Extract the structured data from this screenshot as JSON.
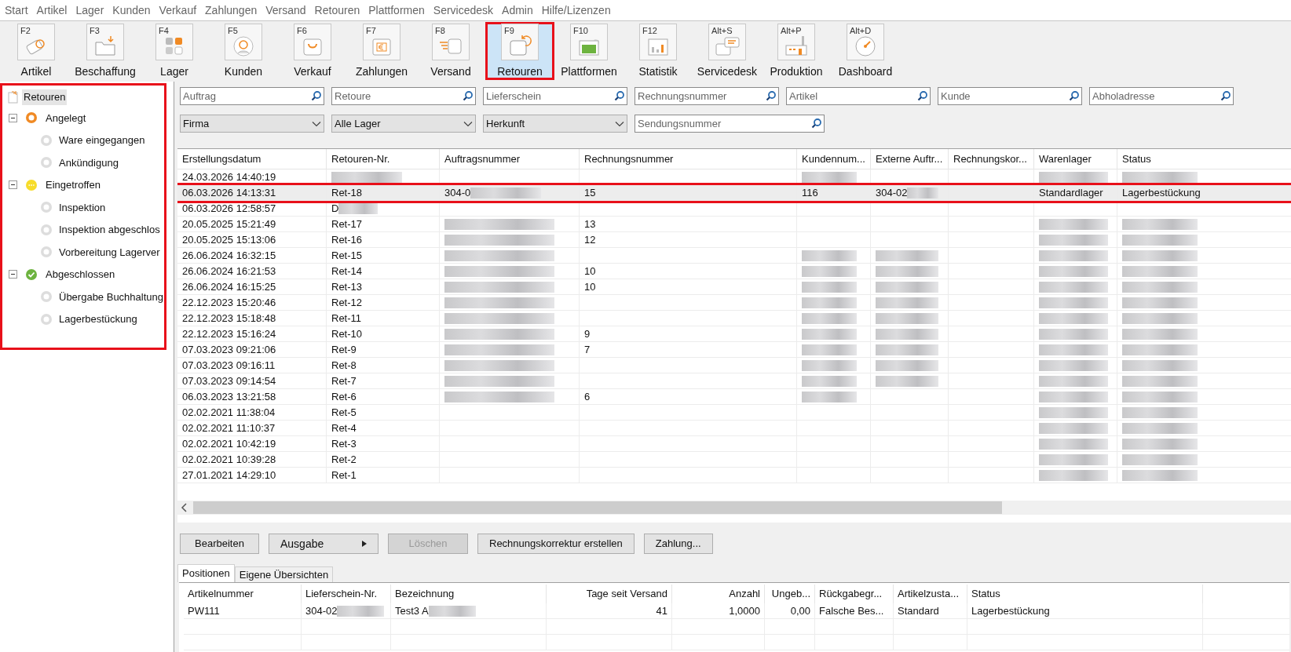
{
  "menu": [
    "Start",
    "Artikel",
    "Lager",
    "Kunden",
    "Verkauf",
    "Zahlungen",
    "Versand",
    "Retouren",
    "Plattformen",
    "Servicedesk",
    "Admin",
    "Hilfe/Lizenzen"
  ],
  "toolbar": [
    {
      "key": "F2",
      "label": "Artikel",
      "selected": false,
      "highlighted": false
    },
    {
      "key": "F3",
      "label": "Beschaffung",
      "selected": false,
      "highlighted": false
    },
    {
      "key": "F4",
      "label": "Lager",
      "selected": false,
      "highlighted": false
    },
    {
      "key": "F5",
      "label": "Kunden",
      "selected": false,
      "highlighted": false
    },
    {
      "key": "F6",
      "label": "Verkauf",
      "selected": false,
      "highlighted": false
    },
    {
      "key": "F7",
      "label": "Zahlungen",
      "selected": false,
      "highlighted": false
    },
    {
      "key": "F8",
      "label": "Versand",
      "selected": false,
      "highlighted": false
    },
    {
      "key": "F9",
      "label": "Retouren",
      "selected": true,
      "highlighted": true
    },
    {
      "key": "F10",
      "label": "Plattformen",
      "selected": false,
      "highlighted": false
    },
    {
      "key": "F12",
      "label": "Statistik",
      "selected": false,
      "highlighted": false
    },
    {
      "key": "Alt+S",
      "label": "Servicedesk",
      "selected": false,
      "highlighted": false
    },
    {
      "key": "Alt+P",
      "label": "Produktion",
      "selected": false,
      "highlighted": false
    },
    {
      "key": "Alt+D",
      "label": "Dashboard",
      "selected": false,
      "highlighted": false
    }
  ],
  "tree": {
    "highlighted": true,
    "root": {
      "label": "Retouren",
      "selected": true,
      "children": [
        {
          "label": "Angelegt",
          "kind": "ring",
          "color": "#f08a24",
          "expanded": true,
          "children": [
            {
              "label": "Ware eingegangen"
            },
            {
              "label": "Ankündigung"
            }
          ]
        },
        {
          "label": "Eingetroffen",
          "kind": "dots",
          "color": "#f7dc2a",
          "expanded": true,
          "children": [
            {
              "label": "Inspektion"
            },
            {
              "label": "Inspektion abgeschlos"
            },
            {
              "label": "Vorbereitung Lagerver"
            }
          ]
        },
        {
          "label": "Abgeschlossen",
          "kind": "check",
          "color": "#6db33f",
          "expanded": true,
          "children": [
            {
              "label": "Übergabe Buchhaltung"
            },
            {
              "label": "Lagerbestückung"
            }
          ]
        }
      ]
    }
  },
  "search_fields": [
    {
      "placeholder": "Auftrag"
    },
    {
      "placeholder": "Retoure"
    },
    {
      "placeholder": "Lieferschein"
    },
    {
      "placeholder": "Rechnungsnummer"
    },
    {
      "placeholder": "Artikel"
    },
    {
      "placeholder": "Kunde"
    },
    {
      "placeholder": "Abholadresse"
    }
  ],
  "dropdowns": [
    {
      "value": "Firma"
    },
    {
      "value": "Alle Lager"
    },
    {
      "value": "Herkunft"
    }
  ],
  "shipment_search": {
    "placeholder": "Sendungsnummer"
  },
  "table": {
    "columns": [
      "Erstellungsdatum",
      "Retouren-Nr.",
      "Auftragsnummer",
      "Rechnungsnummer",
      "Kundennum...",
      "Externe Auftr...",
      "Rechnungskor...",
      "Warenlager",
      "Status"
    ],
    "rows": [
      {
        "selected": false,
        "highlighted": false,
        "cells": [
          {
            "text": "24.03.2026 14:40:19"
          },
          {
            "redacted": true
          },
          {},
          {},
          {
            "redacted": true
          },
          {},
          {},
          {
            "redacted": true
          },
          {
            "redacted": true
          }
        ]
      },
      {
        "selected": true,
        "highlighted": true,
        "cells": [
          {
            "text": "06.03.2026 14:13:31"
          },
          {
            "text": "Ret-18"
          },
          {
            "text": "304-0",
            "redacted": true
          },
          {
            "text": "15"
          },
          {
            "text": "116"
          },
          {
            "text": "304-02",
            "redacted": true
          },
          {},
          {
            "text": "Standardlager"
          },
          {
            "text": "Lagerbestückung"
          }
        ]
      },
      {
        "selected": false,
        "highlighted": false,
        "cells": [
          {
            "text": "06.03.2026 12:58:57"
          },
          {
            "text": "D",
            "redacted": true
          },
          {},
          {},
          {},
          {},
          {},
          {},
          {}
        ]
      },
      {
        "selected": false,
        "highlighted": false,
        "cells": [
          {
            "text": "20.05.2025 15:21:49"
          },
          {
            "text": "Ret-17"
          },
          {
            "redacted": true
          },
          {
            "text": "13"
          },
          {},
          {},
          {},
          {
            "redacted": true
          },
          {
            "redacted": true
          }
        ]
      },
      {
        "selected": false,
        "highlighted": false,
        "cells": [
          {
            "text": "20.05.2025 15:13:06"
          },
          {
            "text": "Ret-16"
          },
          {
            "redacted": true
          },
          {
            "text": "12"
          },
          {},
          {},
          {},
          {
            "redacted": true
          },
          {
            "redacted": true
          }
        ]
      },
      {
        "selected": false,
        "highlighted": false,
        "cells": [
          {
            "text": "26.06.2024 16:32:15"
          },
          {
            "text": "Ret-15"
          },
          {
            "redacted": true
          },
          {},
          {
            "redacted": true
          },
          {
            "redacted": true
          },
          {},
          {
            "redacted": true
          },
          {
            "redacted": true
          }
        ]
      },
      {
        "selected": false,
        "highlighted": false,
        "cells": [
          {
            "text": "26.06.2024 16:21:53"
          },
          {
            "text": "Ret-14"
          },
          {
            "redacted": true
          },
          {
            "text": "10"
          },
          {
            "redacted": true
          },
          {
            "redacted": true
          },
          {},
          {
            "redacted": true
          },
          {
            "redacted": true
          }
        ]
      },
      {
        "selected": false,
        "highlighted": false,
        "cells": [
          {
            "text": "26.06.2024 16:15:25"
          },
          {
            "text": "Ret-13"
          },
          {
            "redacted": true
          },
          {
            "text": "10"
          },
          {
            "redacted": true
          },
          {
            "redacted": true
          },
          {},
          {
            "redacted": true
          },
          {
            "redacted": true
          }
        ]
      },
      {
        "selected": false,
        "highlighted": false,
        "cells": [
          {
            "text": "22.12.2023 15:20:46"
          },
          {
            "text": "Ret-12"
          },
          {
            "redacted": true
          },
          {},
          {
            "redacted": true
          },
          {
            "redacted": true
          },
          {},
          {
            "redacted": true
          },
          {
            "redacted": true
          }
        ]
      },
      {
        "selected": false,
        "highlighted": false,
        "cells": [
          {
            "text": "22.12.2023 15:18:48"
          },
          {
            "text": "Ret-11"
          },
          {
            "redacted": true
          },
          {},
          {
            "redacted": true
          },
          {
            "redacted": true
          },
          {},
          {
            "redacted": true
          },
          {
            "redacted": true
          }
        ]
      },
      {
        "selected": false,
        "highlighted": false,
        "cells": [
          {
            "text": "22.12.2023 15:16:24"
          },
          {
            "text": "Ret-10"
          },
          {
            "redacted": true
          },
          {
            "text": "9"
          },
          {
            "redacted": true
          },
          {
            "redacted": true
          },
          {},
          {
            "redacted": true
          },
          {
            "redacted": true
          }
        ]
      },
      {
        "selected": false,
        "highlighted": false,
        "cells": [
          {
            "text": "07.03.2023 09:21:06"
          },
          {
            "text": "Ret-9"
          },
          {
            "redacted": true
          },
          {
            "text": "7"
          },
          {
            "redacted": true
          },
          {
            "redacted": true
          },
          {},
          {
            "redacted": true
          },
          {
            "redacted": true
          }
        ]
      },
      {
        "selected": false,
        "highlighted": false,
        "cells": [
          {
            "text": "07.03.2023 09:16:11"
          },
          {
            "text": "Ret-8"
          },
          {
            "redacted": true
          },
          {},
          {
            "redacted": true
          },
          {
            "redacted": true
          },
          {},
          {
            "redacted": true
          },
          {
            "redacted": true
          }
        ]
      },
      {
        "selected": false,
        "highlighted": false,
        "cells": [
          {
            "text": "07.03.2023 09:14:54"
          },
          {
            "text": "Ret-7"
          },
          {
            "redacted": true
          },
          {},
          {
            "redacted": true
          },
          {
            "redacted": true
          },
          {},
          {
            "redacted": true
          },
          {
            "redacted": true
          }
        ]
      },
      {
        "selected": false,
        "highlighted": false,
        "cells": [
          {
            "text": "06.03.2023 13:21:58"
          },
          {
            "text": "Ret-6"
          },
          {
            "redacted": true
          },
          {
            "text": "6"
          },
          {
            "redacted": true
          },
          {},
          {},
          {
            "redacted": true
          },
          {
            "redacted": true
          }
        ]
      },
      {
        "selected": false,
        "highlighted": false,
        "cells": [
          {
            "text": "02.02.2021 11:38:04"
          },
          {
            "text": "Ret-5"
          },
          {},
          {},
          {},
          {},
          {},
          {
            "redacted": true
          },
          {
            "redacted": true
          }
        ]
      },
      {
        "selected": false,
        "highlighted": false,
        "cells": [
          {
            "text": "02.02.2021 11:10:37"
          },
          {
            "text": "Ret-4"
          },
          {},
          {},
          {},
          {},
          {},
          {
            "redacted": true
          },
          {
            "redacted": true
          }
        ]
      },
      {
        "selected": false,
        "highlighted": false,
        "cells": [
          {
            "text": "02.02.2021 10:42:19"
          },
          {
            "text": "Ret-3"
          },
          {},
          {},
          {},
          {},
          {},
          {
            "redacted": true
          },
          {
            "redacted": true
          }
        ]
      },
      {
        "selected": false,
        "highlighted": false,
        "cells": [
          {
            "text": "02.02.2021 10:39:28"
          },
          {
            "text": "Ret-2"
          },
          {},
          {},
          {},
          {},
          {},
          {
            "redacted": true
          },
          {
            "redacted": true
          }
        ]
      },
      {
        "selected": false,
        "highlighted": false,
        "cells": [
          {
            "text": "27.01.2021 14:29:10"
          },
          {
            "text": "Ret-1"
          },
          {},
          {},
          {},
          {},
          {},
          {
            "redacted": true
          },
          {
            "redacted": true
          }
        ]
      }
    ]
  },
  "actions": [
    {
      "label": "Bearbeiten",
      "kind": "button",
      "disabled": false
    },
    {
      "label": "Ausgabe",
      "kind": "menu",
      "disabled": false
    },
    {
      "label": "Löschen",
      "kind": "button",
      "disabled": true
    },
    {
      "label": "Rechnungskorrektur erstellen",
      "kind": "button",
      "disabled": false
    },
    {
      "label": "Zahlung...",
      "kind": "button",
      "disabled": false
    }
  ],
  "detail_tabs": [
    {
      "label": "Positionen",
      "selected": true
    },
    {
      "label": "Eigene Übersichten",
      "selected": false
    }
  ],
  "positions": {
    "columns": [
      {
        "label": "Artikelnummer",
        "numeric": false
      },
      {
        "label": "Lieferschein-Nr.",
        "numeric": false
      },
      {
        "label": "Bezeichnung",
        "numeric": false
      },
      {
        "label": "Tage seit Versand",
        "numeric": true
      },
      {
        "label": "Anzahl",
        "numeric": true
      },
      {
        "label": "Ungeb...",
        "numeric": true
      },
      {
        "label": "Rückgabegr...",
        "numeric": false
      },
      {
        "label": "Artikelzusta...",
        "numeric": false
      },
      {
        "label": "Status",
        "numeric": false
      }
    ],
    "rows": [
      {
        "cells": [
          {
            "text": "PW111"
          },
          {
            "text": "304-02",
            "redacted": true
          },
          {
            "text": "Test3 A",
            "redacted": true
          },
          {
            "text": "41"
          },
          {
            "text": "1,0000"
          },
          {
            "text": "0,00"
          },
          {
            "text": "Falsche Bes..."
          },
          {
            "text": "Standard"
          },
          {
            "text": "Lagerbestückung"
          }
        ]
      }
    ]
  }
}
